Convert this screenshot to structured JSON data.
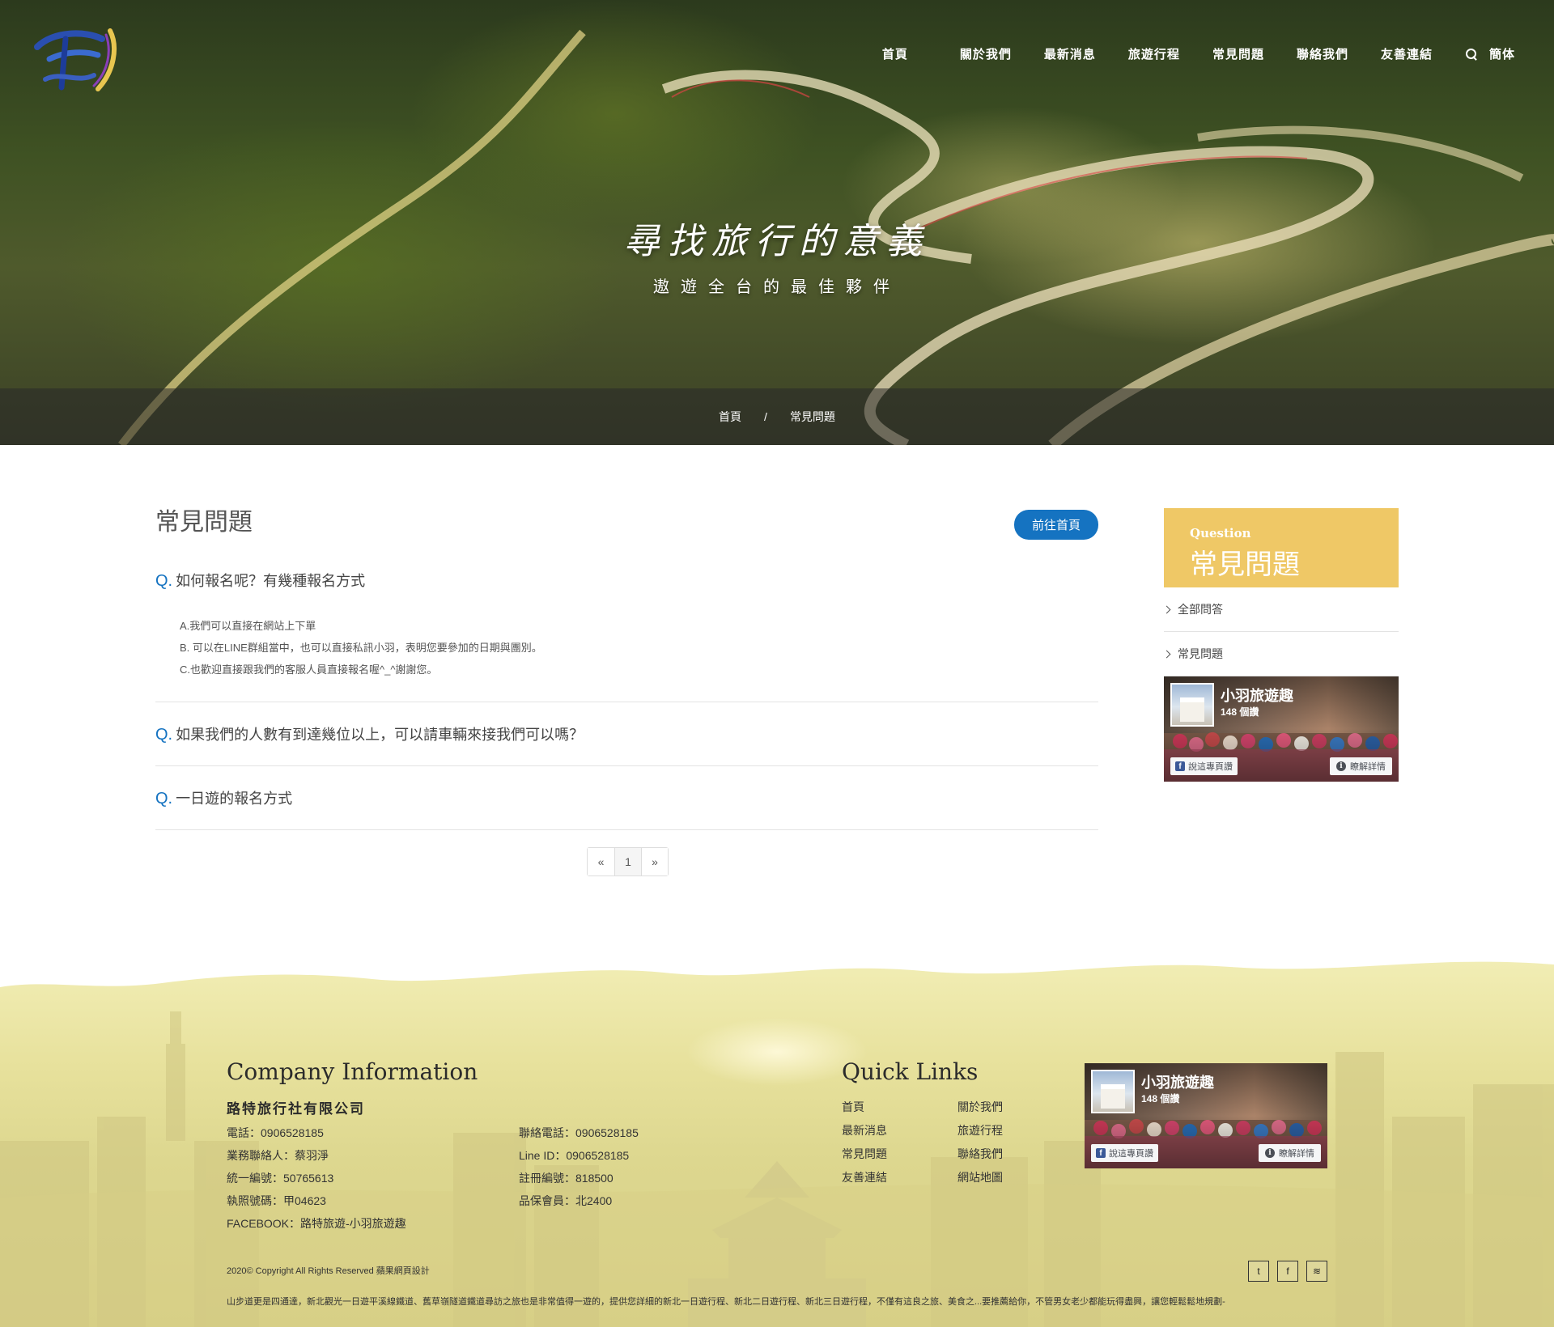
{
  "nav": {
    "items": [
      "首頁",
      "關於我們",
      "最新消息",
      "旅遊行程",
      "常見問題",
      "聯絡我們",
      "友善連結"
    ],
    "lang": "簡体",
    "search_icon": "search-icon"
  },
  "hero": {
    "title": "尋找旅行的意義",
    "subtitle": "遨遊全台的最佳夥伴"
  },
  "breadcrumb": {
    "home": "首頁",
    "sep": "/",
    "current": "常見問題"
  },
  "main": {
    "title": "常見問題",
    "home_button": "前往首頁",
    "faqs": [
      {
        "q_mark": "Q.",
        "question": "如何報名呢？有幾種報名方式",
        "answers": [
          "A.我們可以直接在網站上下單",
          "B. 可以在LINE群組當中，也可以直接私訊小羽，表明您要參加的日期與團別。",
          "C.也歡迎直接跟我們的客服人員直接報名喔^_^謝謝您。"
        ]
      },
      {
        "q_mark": "Q.",
        "question": "如果我們的人數有到達幾位以上，可以請車輛來接我們可以嗎？"
      },
      {
        "q_mark": "Q.",
        "question": "一日遊的報名方式"
      }
    ],
    "pager": {
      "prev": "«",
      "current": "1",
      "next": "»"
    }
  },
  "sidebar": {
    "header_sub": "Question",
    "header_main": "常見問題",
    "links": [
      "全部問答",
      "常見問題"
    ]
  },
  "facebook": {
    "name": "小羽旅遊趣",
    "likes": "148 個讚",
    "share": "說這專頁讚",
    "info": "瞭解詳情",
    "fb_glyph": "f",
    "info_glyph": "i"
  },
  "footer": {
    "company_title": "Company Information",
    "company_name": "路特旅行社有限公司",
    "left_info": [
      "電話：0906528185",
      "業務聯絡人：蔡羽淨",
      "統一編號：50765613",
      "執照號碼：甲04623",
      "FACEBOOK：路特旅遊-小羽旅遊趣"
    ],
    "right_info": [
      "聯絡電話：0906528185",
      "Line ID：0906528185",
      "註冊編號：818500",
      "品保會員：北2400"
    ],
    "quick_title": "Quick Links",
    "quick_links_col1": [
      "首頁",
      "最新消息",
      "常見問題",
      "友善連結"
    ],
    "quick_links_col2": [
      "關於我們",
      "旅遊行程",
      "聯絡我們",
      "網站地圖"
    ],
    "copyright": "2020© Copyright All Rights Reserved 蘋果網頁設計",
    "social_icons": [
      "twitter-icon",
      "facebook-icon",
      "rss-icon"
    ],
    "social_glyphs": [
      "t",
      "f",
      "≋"
    ],
    "marquee": "山步道更是四通達，新北觀光一日遊平溪線鐵道、舊草嶺隧道鐵道尋訪之旅也是非常值得一遊的，提供您詳細的新北一日遊行程、新北二日遊行程、新北三日遊行程，不僅有這良之旅、美食之...要推薦給你，不管男女老少都能玩得盡興，讓您輕鬆鬆地規劃-"
  }
}
